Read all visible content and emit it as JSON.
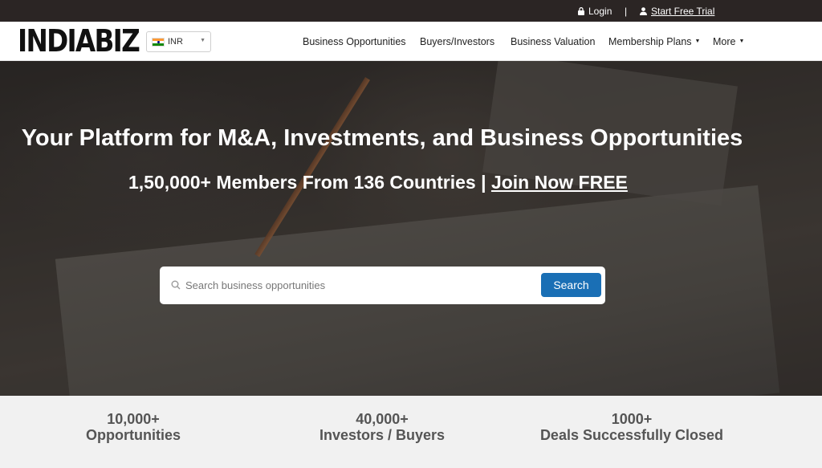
{
  "topbar": {
    "login_label": "Login",
    "separator": "|",
    "trial_label": "Start Free Trial"
  },
  "brand": {
    "logo_text": "INDIABIZ"
  },
  "currency": {
    "selected": "INR"
  },
  "nav": {
    "items": [
      {
        "label": "Business Opportunities"
      },
      {
        "label": "Buyers/Investors"
      },
      {
        "label": "Business Valuation"
      },
      {
        "label": "Membership Plans",
        "dropdown": true
      },
      {
        "label": "More",
        "dropdown": true
      }
    ]
  },
  "hero": {
    "title": "Your Platform for M&A, Investments, and Business Opportunities",
    "subtitle_prefix": "1,50,000+ Members From 136 Countries | ",
    "join_label": "Join Now FREE"
  },
  "search": {
    "placeholder": "Search business opportunities",
    "value": "",
    "button_label": "Search"
  },
  "stats": [
    {
      "number": "10,000+",
      "label": "Opportunities"
    },
    {
      "number": "40,000+",
      "label": "Investors / Buyers"
    },
    {
      "number": "1000+",
      "label": "Deals Successfully Closed"
    }
  ],
  "icons": {
    "login": "lock-icon",
    "trial": "user-icon",
    "search": "search-icon",
    "flag": "india-flag-icon"
  },
  "colors": {
    "topbar_bg": "#2b2524",
    "search_button": "#1a6fb5",
    "stats_bg": "#f1f1f1"
  }
}
